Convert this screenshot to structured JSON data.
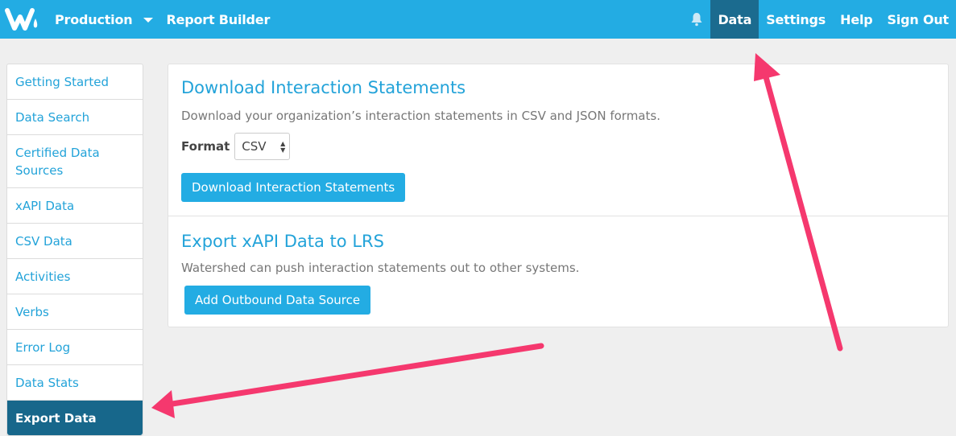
{
  "topbar": {
    "left_items": [
      "Production",
      "Report Builder"
    ],
    "right_links": [
      {
        "label": "Data",
        "active": true
      },
      {
        "label": "Settings",
        "active": false
      },
      {
        "label": "Help",
        "active": false
      },
      {
        "label": "Sign Out",
        "active": false
      }
    ],
    "logo_icon": "watershed-logo-icon",
    "bell_icon": "bell-icon",
    "dropdown_icon": "caret-down-icon"
  },
  "sidebar": {
    "items": [
      {
        "label": "Getting Started"
      },
      {
        "label": "Data Search"
      },
      {
        "label": "Certified Data Sources"
      },
      {
        "label": "xAPI Data"
      },
      {
        "label": "CSV Data"
      },
      {
        "label": "Activities"
      },
      {
        "label": "Verbs"
      },
      {
        "label": "Error Log"
      },
      {
        "label": "Data Stats"
      },
      {
        "label": "Export Data"
      }
    ],
    "active_index": 9
  },
  "download": {
    "title": "Download Interaction Statements",
    "description": "Download your organization’s interaction statements in CSV and JSON formats.",
    "format_label": "Format",
    "format_value": "CSV",
    "button_label": "Download Interaction Statements"
  },
  "export": {
    "title": "Export xAPI Data to LRS",
    "description": "Watershed can push interaction statements out to other systems.",
    "button_label": "Add Outbound Data Source"
  },
  "colors": {
    "topbar": "#23ace3",
    "active_nav": "#1b6b8f",
    "sidebar_active": "#17678b",
    "link": "#23a3d9",
    "annotation_arrow": "#f5386e"
  }
}
